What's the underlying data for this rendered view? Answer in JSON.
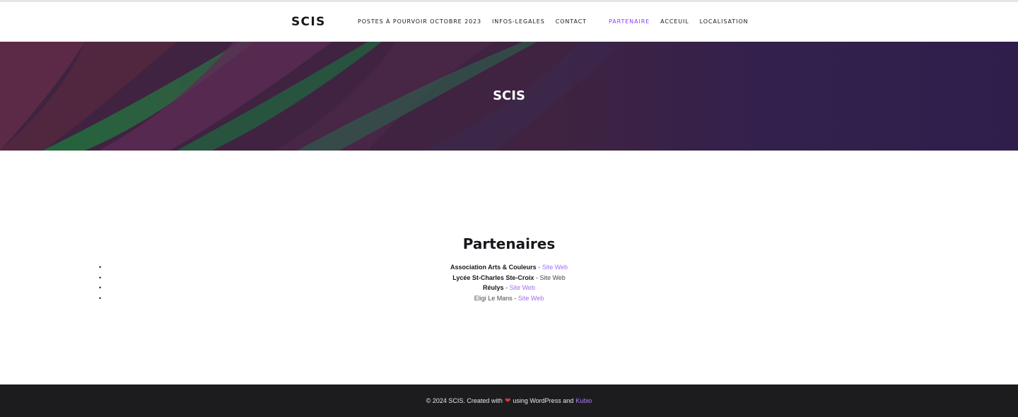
{
  "site": {
    "logo": "SCIS"
  },
  "nav": {
    "items": [
      {
        "label": "POSTES À POURVOIR OCTOBRE 2023"
      },
      {
        "label": "INFOS-LEGALES"
      },
      {
        "label": "CONTACT"
      },
      {
        "label": "PARTENAIRE"
      },
      {
        "label": "ACCEUIL"
      },
      {
        "label": "LOCALISATION"
      }
    ],
    "active_color": "#8a3ffc"
  },
  "hero": {
    "title": "SCIS"
  },
  "main": {
    "heading": "Partenaires",
    "bullet": "•",
    "separator": "-",
    "partners": [
      {
        "name": "Association Arts & Couleurs",
        "link": "Site Web"
      },
      {
        "name": "Lycée St-Charles Ste-Croix",
        "link": "Site Web"
      },
      {
        "name": "Réulys",
        "link": "Site Web"
      },
      {
        "name": "Eligi Le Mans",
        "link": "Site Web"
      }
    ]
  },
  "footer": {
    "prefix": "© 2024 SCIS. Created with",
    "heart": "❤",
    "middle": "using WordPress and",
    "link": "Kubio"
  },
  "colors": {
    "accent": "#8a3ffc",
    "link": "#a26cf7",
    "footer_bg": "#1c1c1f",
    "heart": "#e0323f"
  }
}
